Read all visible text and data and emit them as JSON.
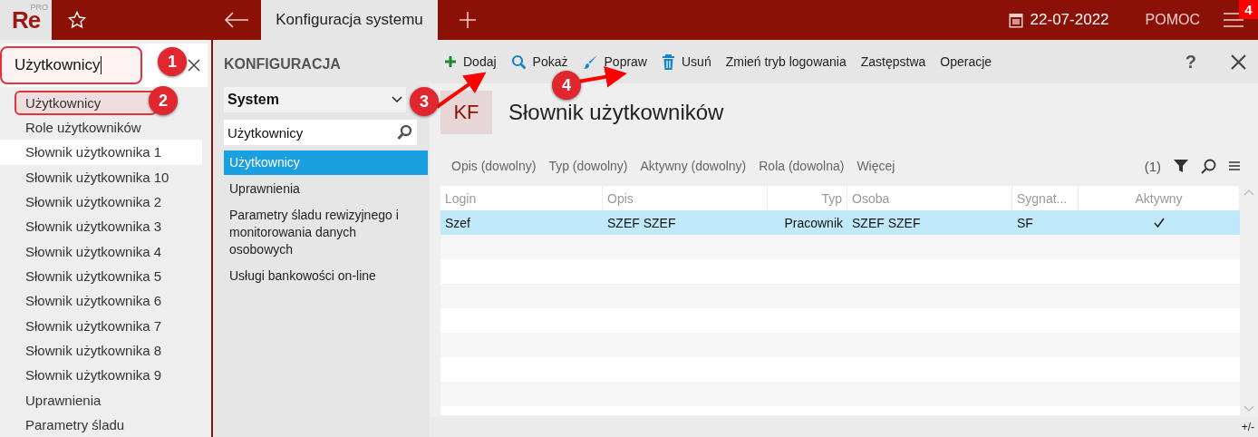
{
  "header": {
    "logo": "Re",
    "logo_edition": "PRO",
    "tab": {
      "label": "Konfiguracja systemu",
      "selected": true
    },
    "date": "22-07-2022",
    "help": "POMOC",
    "notification_badge": "4"
  },
  "sidebar": {
    "search": {
      "value": "Użytkownicy",
      "highlighted": true
    },
    "items": [
      {
        "label": "Użytkownicy",
        "selected": false,
        "highlighted": true
      },
      {
        "label": "Role użytkowników",
        "selected": false,
        "highlighted": false
      },
      {
        "label": "Słownik użytkownika 1",
        "selected": true,
        "highlighted": false
      },
      {
        "label": "Słownik użytkownika 10",
        "selected": false,
        "highlighted": false
      },
      {
        "label": "Słownik użytkownika 2",
        "selected": false,
        "highlighted": false
      },
      {
        "label": "Słownik użytkownika 3",
        "selected": false,
        "highlighted": false
      },
      {
        "label": "Słownik użytkownika 4",
        "selected": false,
        "highlighted": false
      },
      {
        "label": "Słownik użytkownika 5",
        "selected": false,
        "highlighted": false
      },
      {
        "label": "Słownik użytkownika 6",
        "selected": false,
        "highlighted": false
      },
      {
        "label": "Słownik użytkownika 7",
        "selected": false,
        "highlighted": false
      },
      {
        "label": "Słownik użytkownika 8",
        "selected": false,
        "highlighted": false
      },
      {
        "label": "Słownik użytkownika 9",
        "selected": false,
        "highlighted": false
      },
      {
        "label": "Uprawnienia",
        "selected": false,
        "highlighted": false
      },
      {
        "label": "Parametry śladu",
        "selected": false,
        "highlighted": false
      }
    ]
  },
  "config_panel": {
    "title": "KONFIGURACJA",
    "dropdown": "System",
    "search": {
      "value": "Użytkownicy"
    },
    "items": [
      {
        "label": "Użytkownicy",
        "selected": true
      },
      {
        "label": "Uprawnienia",
        "selected": false
      },
      {
        "label": "Parametry śladu rewizyjnego i monitorowania danych osobowych",
        "selected": false
      },
      {
        "label": "Usługi bankowości on-line",
        "selected": false
      }
    ]
  },
  "toolbar": {
    "buttons": [
      {
        "label": "Dodaj",
        "kind": "add"
      },
      {
        "label": "Pokaż",
        "kind": "show"
      },
      {
        "label": "Popraw",
        "kind": "edit"
      },
      {
        "label": "Usuń",
        "kind": "delete"
      },
      {
        "label": "Zmień tryb logowania",
        "kind": "text"
      },
      {
        "label": "Zastępstwa",
        "kind": "text"
      },
      {
        "label": "Operacje",
        "kind": "text"
      }
    ],
    "help": "?"
  },
  "page": {
    "badge": "KF",
    "title": "Słownik użytkowników"
  },
  "filters": {
    "items": [
      "Opis (dowolny)",
      "Typ (dowolny)",
      "Aktywny (dowolny)",
      "Rola (dowolna)",
      "Więcej"
    ],
    "count": "(1)"
  },
  "table": {
    "columns": [
      {
        "label": "Login"
      },
      {
        "label": "Opis"
      },
      {
        "label": "Typ"
      },
      {
        "label": "Osoba"
      },
      {
        "label": "Sygnat..."
      },
      {
        "label": "Aktywny"
      }
    ],
    "rows": [
      {
        "selected": true,
        "login": "Szef",
        "opis": "SZEF SZEF",
        "typ": "Pracownik",
        "osoba": "SZEF SZEF",
        "sygnatura": "SF",
        "active": true
      }
    ]
  },
  "status_bar": {
    "zoom": "+/-"
  },
  "annotations": [
    {
      "number": "1"
    },
    {
      "number": "2"
    },
    {
      "number": "3"
    },
    {
      "number": "4"
    }
  ]
}
